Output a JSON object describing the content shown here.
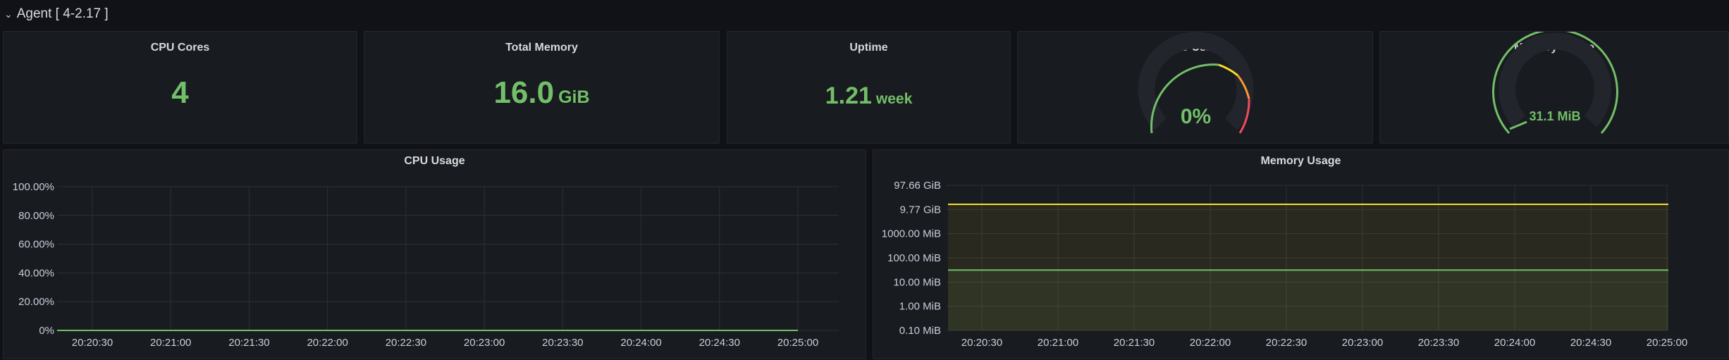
{
  "row": {
    "title": "Agent [ 4-2.17 ]"
  },
  "stats": {
    "cpu_cores": {
      "title": "CPU Cores",
      "value": "4",
      "unit": ""
    },
    "total_memory": {
      "title": "Total Memory",
      "value": "16.0",
      "unit": "GiB"
    },
    "uptime": {
      "title": "Uptime",
      "value": "1.21",
      "unit": "week"
    },
    "cpu_gauge": {
      "title": "CPU Usage",
      "value": "0%",
      "fraction": 0.0
    },
    "mem_gauge": {
      "title": "Memory Usage",
      "value": "31.1 MiB",
      "fraction": 0.06
    }
  },
  "colors": {
    "green": "#73bf69",
    "yellow": "#fade2a",
    "orange": "#ff9830",
    "red": "#f2495c",
    "grid": "#2c3235"
  },
  "chart_data": [
    {
      "type": "line",
      "title": "CPU Usage",
      "x": [
        "20:20:30",
        "20:21:00",
        "20:21:30",
        "20:22:00",
        "20:22:30",
        "20:23:00",
        "20:23:30",
        "20:24:00",
        "20:24:30",
        "20:25:00"
      ],
      "y_ticks": [
        "100.00%",
        "80.00%",
        "60.00%",
        "40.00%",
        "20.00%",
        "0%"
      ],
      "ylim": [
        0,
        100
      ],
      "series": [
        {
          "values": [
            0,
            0,
            0,
            0,
            0,
            0,
            0,
            0,
            0,
            0
          ],
          "color": "#73bf69"
        }
      ],
      "grid": true
    },
    {
      "type": "area",
      "title": "Memory Usage",
      "x": [
        "20:20:30",
        "20:21:00",
        "20:21:30",
        "20:22:00",
        "20:22:30",
        "20:23:00",
        "20:23:30",
        "20:24:00",
        "20:24:30",
        "20:25:00"
      ],
      "y_ticks": [
        "97.66 GiB",
        "9.77 GiB",
        "1000.00 MiB",
        "100.00 MiB",
        "10.00 MiB",
        "1.00 MiB",
        "0.10 MiB"
      ],
      "y_scale": "log",
      "series": [
        {
          "value_mib": 16384,
          "color": "#fade2a"
        },
        {
          "value_mib": 31.1,
          "color": "#73bf69"
        }
      ],
      "grid": true
    }
  ]
}
